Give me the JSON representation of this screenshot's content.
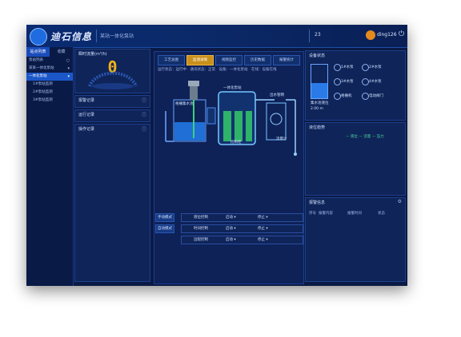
{
  "app": {
    "brand": "迪石信息",
    "breadcrumb": "某站一体化泵站",
    "alarm": "23",
    "user": "ding126"
  },
  "sidebar": {
    "tabs": [
      {
        "label": "站点列表"
      },
      {
        "label": "收藏"
      }
    ],
    "items": [
      {
        "label": "泵站列表",
        "active": false
      },
      {
        "label": "某某一体化泵站",
        "active": false
      },
      {
        "label": "一体化泵站",
        "active": true
      },
      {
        "label": "1#泵站监测",
        "active": false
      },
      {
        "label": "2#泵站监测",
        "active": false
      },
      {
        "label": "3#泵站监测",
        "active": false
      }
    ]
  },
  "left_panels": {
    "flow": {
      "title": "瞬时流量(m³/h)",
      "value": "0"
    },
    "p1": {
      "title": "报警记录"
    },
    "p2": {
      "title": "运行记录"
    },
    "p3": {
      "title": "操作记录"
    }
  },
  "center": {
    "tabs": [
      "工艺总图",
      "监测详情",
      "视频监控",
      "历史数据",
      "报警统计"
    ],
    "active_tab": 1,
    "info": "运行状态：运行中　通讯状态：正常　设备：一体化泵站　在线：设备在线",
    "diagram_labels": {
      "tank1": "格栅集水池",
      "tank2": "一体化泵站",
      "cabinet": "控制柜",
      "pipe": "出水管网",
      "valve": "阀门",
      "flow": "流量计"
    },
    "settings": [
      {
        "button": "手动模式",
        "c1": "液位控制",
        "c2": "启动 ▾",
        "c3": "停止 ▾"
      },
      {
        "button": "自动模式",
        "c1": "时间控制",
        "c2": "启动 ▾",
        "c3": "停止 ▾"
      },
      {
        "button": "",
        "c1": "远程控制",
        "c2": "启动 ▾",
        "c3": "停止 ▾"
      }
    ]
  },
  "right": {
    "status_title": "设备状态",
    "tank_label": "集水池液位",
    "tank_value": "2.00 m",
    "fill_fraction": 0.45,
    "status_items": [
      "1#水泵",
      "2#水泵",
      "3#水泵",
      "4#水泵",
      "格栅机",
      "电动阀门"
    ],
    "trend_title": "液位趋势",
    "trend_legend": "— 液位 — 流量 — 压力",
    "alarm_title": "报警信息",
    "alarm_row": [
      "序号",
      "报警内容",
      "报警时间",
      "状态"
    ]
  },
  "colors": {
    "accent": "#f3b21a",
    "primary": "#1b57c9",
    "background": "#0b1a44"
  }
}
